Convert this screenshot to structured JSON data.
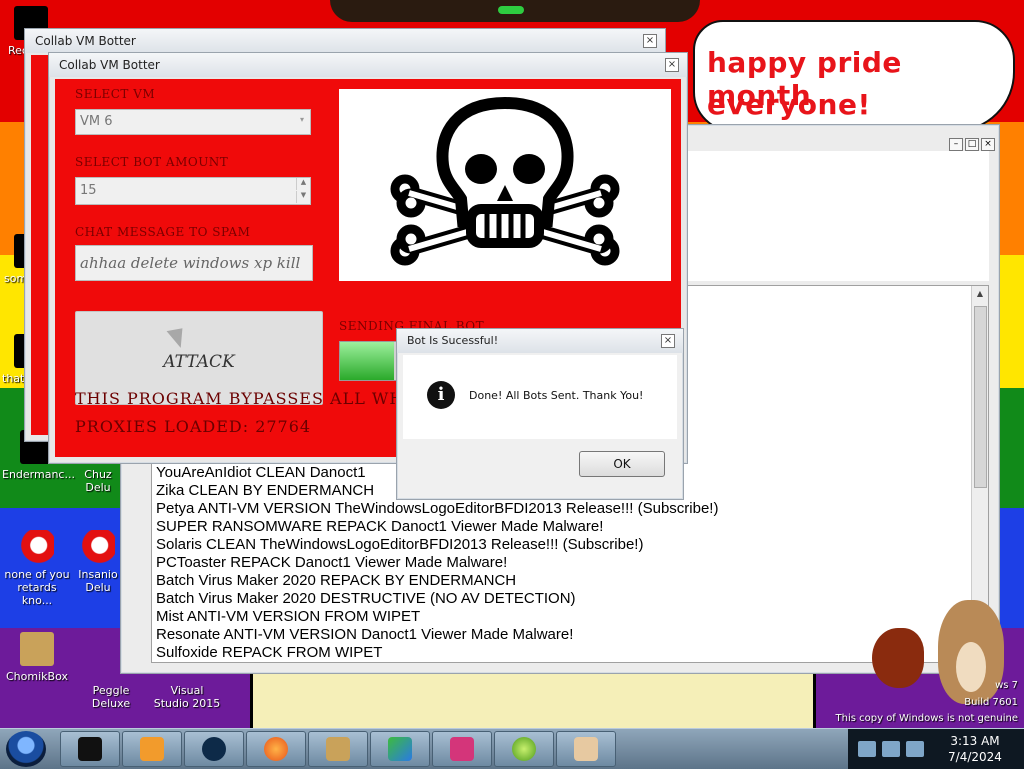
{
  "desktop": {
    "bubble_lines": [
      "happy pride month",
      "everyone!"
    ],
    "icons": [
      {
        "label": "Rec"
      },
      {
        "label": "som"
      },
      {
        "label": "that"
      },
      {
        "label": "Endermanc..."
      },
      {
        "label": "Chuz Delu"
      },
      {
        "label": "none of you retards kno..."
      },
      {
        "label": "Insanio Delu"
      },
      {
        "label": "ChomikBox"
      },
      {
        "label": "Peggle Deluxe"
      },
      {
        "label": "Visual Studio 2015"
      }
    ],
    "watermark": {
      "line1": "ws 7",
      "line2": "Build 7601",
      "line3": "This copy of Windows is not genuine"
    }
  },
  "botter_back": {
    "title": "Collab VM Botter"
  },
  "botter": {
    "title": "Collab VM Botter",
    "select_vm_label": "SELECT VM",
    "select_vm_value": "VM 6",
    "bot_amount_label": "SELECT BOT AMOUNT",
    "bot_amount_value": "15",
    "chat_label": "CHAT MESSAGE TO SPAM",
    "chat_value": "ahhaa delete windows xp kill",
    "attack_label": "ATTACK",
    "status_label": "SENDING FINAL BOT",
    "progress_fraction": 0.9,
    "bypass_text": "THIS PROGRAM BYPASSES ALL WHITE",
    "proxies_text": "PROXIES LOADED: 27764"
  },
  "log_window": {
    "lines": [
      "YouAreAnIdiot CLEAN Danoct1",
      "Zika CLEAN BY ENDERMANCH",
      "Petya ANTI-VM VERSION TheWindowsLogoEditorBFDI2013 Release!!! (Subscribe!)",
      "SUPER RANSOMWARE REPACK Danoct1 Viewer Made Malware!",
      "Solaris CLEAN TheWindowsLogoEditorBFDI2013 Release!!! (Subscribe!)",
      "PCToaster REPACK Danoct1 Viewer Made Malware!",
      "Batch Virus Maker 2020 REPACK BY ENDERMANCH",
      "Batch Virus Maker 2020 DESTRUCTIVE (NO AV DETECTION)",
      "Mist ANTI-VM VERSION FROM WIPET",
      "Resonate ANTI-VM VERSION Danoct1 Viewer Made Malware!",
      "Sulfoxide REPACK FROM WIPET"
    ]
  },
  "message_box": {
    "title": "Bot Is Sucessful!",
    "message": "Done! All Bots Sent. Thank You!",
    "ok_label": "OK"
  },
  "taskbar": {
    "time": "3:13 AM",
    "date": "7/4/2024"
  },
  "colors": {
    "botter_bg": "#f00a0a",
    "bubble_text": "#e8141a"
  }
}
